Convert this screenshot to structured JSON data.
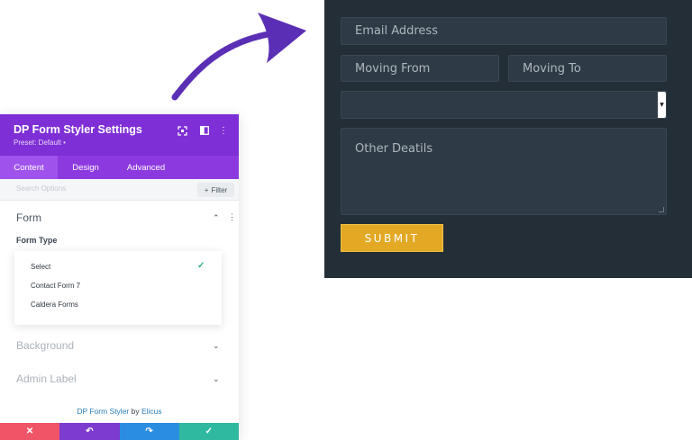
{
  "colors": {
    "panel_header": "#7e2fd6",
    "tabs_bar": "#8c3ae0",
    "preview_bg": "#232e37",
    "field_bg": "#2e3a45",
    "submit_bg": "#e3a924",
    "arrow": "#5b2fb5",
    "check": "#2fb484",
    "footer_cancel": "#ef5567",
    "footer_undo": "#7e3bd0",
    "footer_redo": "#2b8de0",
    "footer_save": "#2fb9a1"
  },
  "preview": {
    "email_placeholder": "Email Address",
    "moving_from_placeholder": "Moving From",
    "moving_to_placeholder": "Moving To",
    "other_details_placeholder": "Other Deatils",
    "submit_label": "SUBMIT"
  },
  "panel": {
    "title": "DP Form Styler Settings",
    "preset": "Preset: Default •",
    "tabs": [
      {
        "label": "Content",
        "active": true
      },
      {
        "label": "Design",
        "active": false
      },
      {
        "label": "Advanced",
        "active": false
      }
    ],
    "search_placeholder": "Search Options",
    "filter_label": "Filter",
    "sections": {
      "form": "Form",
      "form_type_label": "Form Type",
      "background": "Background",
      "admin_label": "Admin Label"
    },
    "form_type_options": [
      "Select",
      "Contact Form 7",
      "Caldera Forms"
    ],
    "selected_option": "Select",
    "credit": {
      "product": "DP Form Styler",
      "by": "by",
      "author": "Elicus"
    }
  },
  "icons": {
    "expand": "expand-icon",
    "layout": "layout-icon",
    "more": "more-vertical-icon",
    "check": "check-icon",
    "cancel": "close-icon",
    "undo": "undo-icon",
    "redo": "redo-icon",
    "save": "check-icon"
  }
}
